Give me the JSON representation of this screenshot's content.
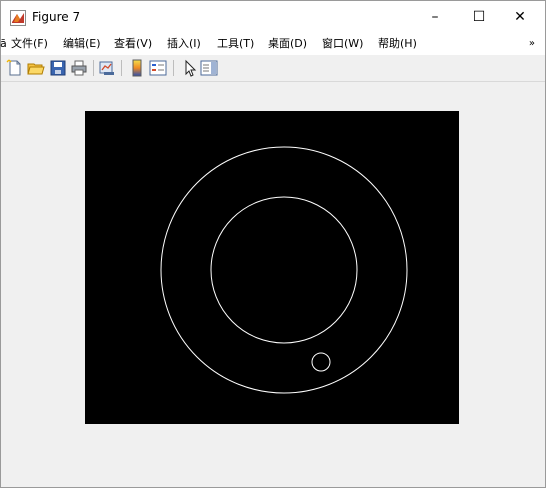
{
  "window": {
    "title": "Figure 7",
    "accent_color": "#ffffff"
  },
  "controls": {
    "minimize": "–",
    "maximize": "☐",
    "close": "✕"
  },
  "menu": {
    "edge_char": "ā",
    "items": [
      "文件(F)",
      "编辑(E)",
      "查看(V)",
      "插入(I)",
      "工具(T)",
      "桌面(D)",
      "窗口(W)",
      "帮助(H)"
    ],
    "overflow_icon": "chevron-double-right"
  },
  "toolbar": {
    "icons": [
      "new-figure-icon",
      "open-file-icon",
      "save-icon",
      "print-icon",
      "link-plot-icon",
      "insert-colorbar-icon",
      "insert-legend-icon",
      "edit-plot-pointer-icon",
      "show-plot-tools-icon"
    ]
  },
  "figure": {
    "background_color": "#000000",
    "line_color": "#ffffff",
    "shapes": [
      "outer-ring",
      "inner-ring",
      "small-circle"
    ]
  }
}
